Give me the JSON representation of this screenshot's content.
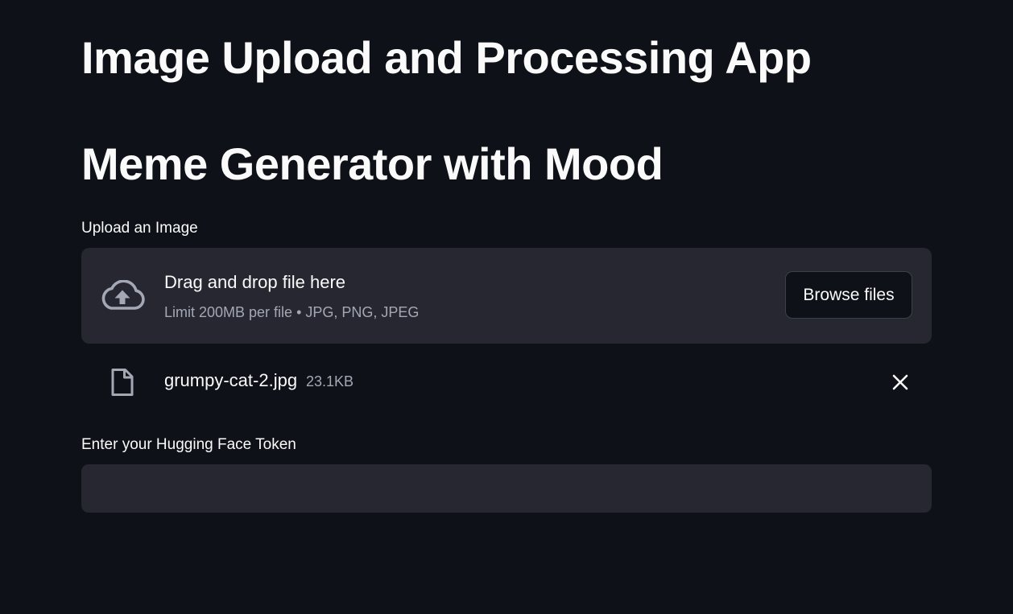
{
  "page": {
    "title": "Image Upload and Processing App",
    "subtitle": "Meme Generator with Mood"
  },
  "uploader": {
    "label": "Upload an Image",
    "drop_text": "Drag and drop file here",
    "limit_text": "Limit 200MB per file • JPG, PNG, JPEG",
    "browse_label": "Browse files",
    "icon": "cloud-upload-icon"
  },
  "uploaded_file": {
    "name": "grumpy-cat-2.jpg",
    "size": "23.1KB",
    "icon": "file-icon",
    "remove_icon": "close-icon"
  },
  "token": {
    "label": "Enter your Hugging Face Token",
    "value": "",
    "placeholder": ""
  },
  "colors": {
    "background": "#0e1117",
    "surface": "#262730",
    "text": "#fafafa",
    "muted_text": "#a3a8b4"
  }
}
